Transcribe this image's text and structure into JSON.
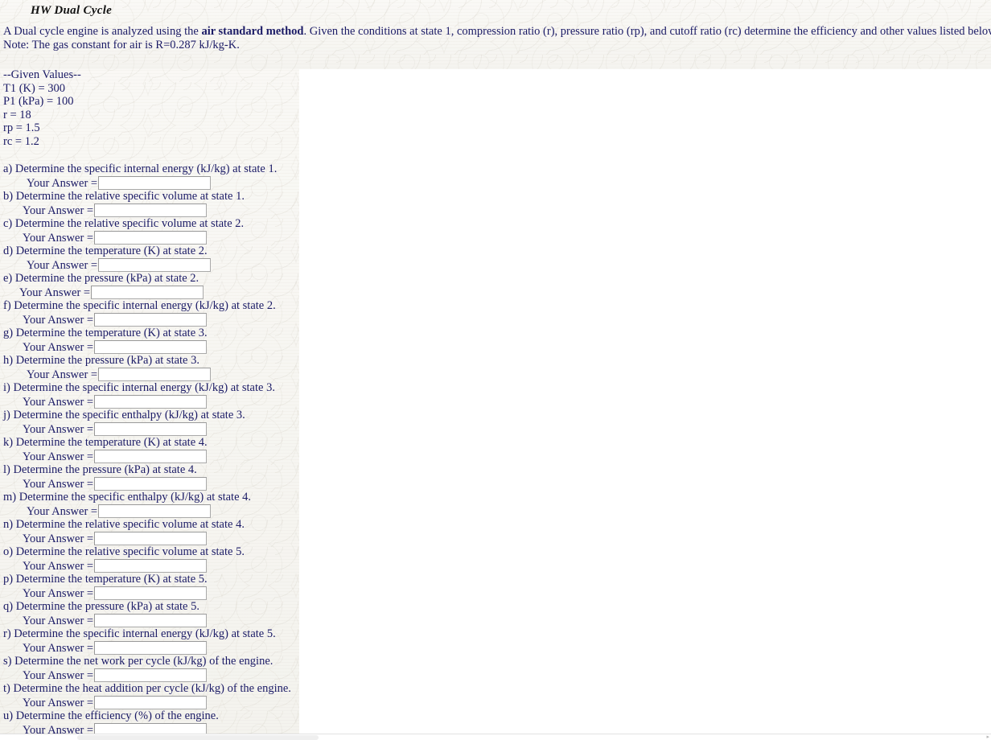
{
  "document": {
    "title": "HW Dual Cycle",
    "intro_part1": "A Dual cycle engine is analyzed using the ",
    "intro_bold": "air standard method",
    "intro_part2": ". Given the conditions at state 1, compression ratio (r), pressure ratio (rp), and cutoff ratio (rc) determine the efficiency and other values listed below.",
    "note": "Note: The gas constant for air is R=0.287 kJ/kg-K."
  },
  "given": {
    "heading": "--Given Values--",
    "values": [
      "T1 (K) = 300",
      "P1 (kPa) = 100",
      "r = 18",
      "rp = 1.5",
      "rc = 1.2"
    ]
  },
  "answer_label": "Your Answer =",
  "questions": [
    {
      "letter": "a",
      "text": "a) Determine the specific internal energy (kJ/kg) at state 1.",
      "value": ""
    },
    {
      "letter": "b",
      "text": "b) Determine the relative specific volume at state 1.",
      "value": ""
    },
    {
      "letter": "c",
      "text": "c) Determine the relative specific volume at state 2.",
      "value": ""
    },
    {
      "letter": "d",
      "text": "d) Determine the temperature (K) at state 2.",
      "value": ""
    },
    {
      "letter": "e",
      "text": "e) Determine the pressure (kPa) at state 2.",
      "value": ""
    },
    {
      "letter": "f",
      "text": "f) Determine the specific internal energy (kJ/kg) at state 2.",
      "value": ""
    },
    {
      "letter": "g",
      "text": "g) Determine the temperature (K) at state 3.",
      "value": ""
    },
    {
      "letter": "h",
      "text": "h) Determine the pressure (kPa) at state 3.",
      "value": ""
    },
    {
      "letter": "i",
      "text": "i) Determine the specific internal energy (kJ/kg) at state 3.",
      "value": ""
    },
    {
      "letter": "j",
      "text": "j) Determine the specific enthalpy (kJ/kg) at state 3.",
      "value": ""
    },
    {
      "letter": "k",
      "text": "k) Determine the temperature (K) at state 4.",
      "value": ""
    },
    {
      "letter": "l",
      "text": "l) Determine the pressure (kPa) at state 4.",
      "value": ""
    },
    {
      "letter": "m",
      "text": "m) Determine the specific enthalpy (kJ/kg) at state 4.",
      "value": ""
    },
    {
      "letter": "n",
      "text": "n) Determine the relative specific volume at state 4.",
      "value": ""
    },
    {
      "letter": "o",
      "text": "o) Determine the relative specific volume at state 5.",
      "value": ""
    },
    {
      "letter": "p",
      "text": "p) Determine the temperature (K) at state 5.",
      "value": ""
    },
    {
      "letter": "q",
      "text": "q) Determine the pressure (kPa) at state 5.",
      "value": ""
    },
    {
      "letter": "r",
      "text": "r) Determine the specific internal energy (kJ/kg) at state 5.",
      "value": ""
    },
    {
      "letter": "s",
      "text": "s) Determine the net work per cycle (kJ/kg) of the engine.",
      "value": ""
    },
    {
      "letter": "t",
      "text": "t) Determine the heat addition per cycle (kJ/kg) of the engine.",
      "value": ""
    },
    {
      "letter": "u",
      "text": "u) Determine the efficiency (%) of the engine.",
      "value": ""
    }
  ],
  "colors": {
    "text": "#1b1b66",
    "title": "#111111",
    "paper": "#f6f5f1",
    "panel": "#ffffff",
    "input_border": "#a9a9a9"
  }
}
